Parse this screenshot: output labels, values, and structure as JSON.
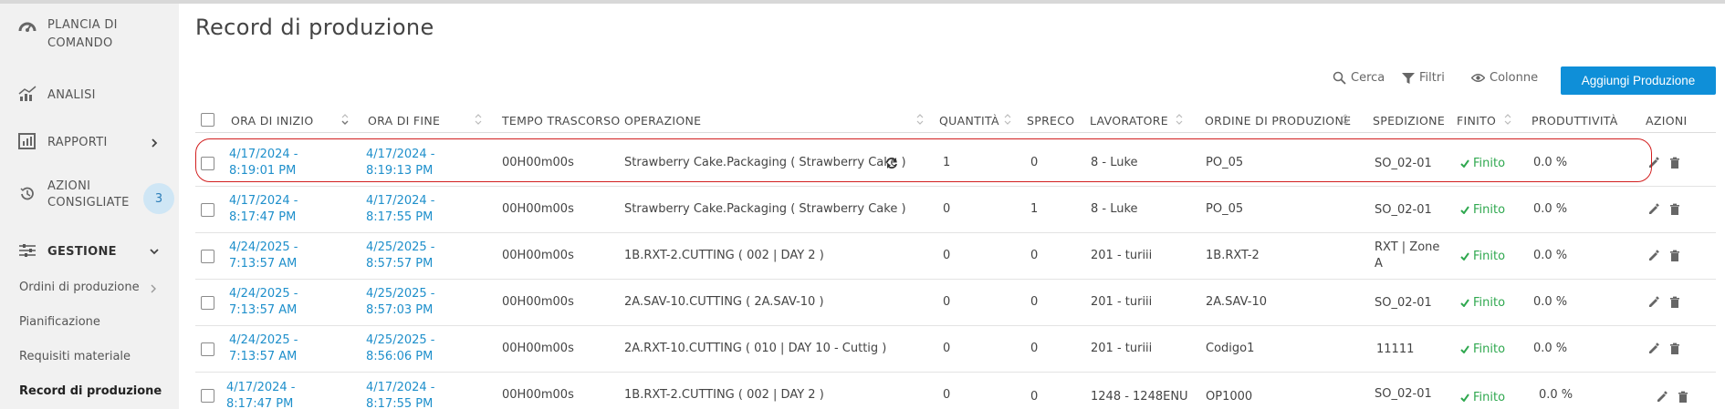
{
  "sidebar": {
    "dashboard_label": "PLANCIA DI COMANDO",
    "analysis_label": "ANALISI",
    "reports_label": "RAPPORTI",
    "suggested_label": "AZIONI CONSIGLIATE",
    "suggested_count": "3",
    "management_label": "GESTIONE",
    "sub_items": [
      {
        "label": "Ordini di produzione"
      },
      {
        "label": "Pianificazione"
      },
      {
        "label": "Requisiti materiale"
      },
      {
        "label": "Record di produzione"
      }
    ]
  },
  "page": {
    "title": "Record di produzione"
  },
  "toolbar": {
    "search_label": "Cerca",
    "filters_label": "Filtri",
    "columns_label": "Colonne",
    "add_label": "Aggiungi Produzione"
  },
  "table": {
    "columns": [
      "ORA DI INIZIO",
      "ORA DI FINE",
      "TEMPO TRASCORSO",
      "OPERAZIONE",
      "QUANTITÀ",
      "SPRECO",
      "LAVORATORE",
      "ORDINE DI PRODUZIONE",
      "SPEDIZIONE",
      "FINITO",
      "PRODUTTIVITÀ",
      "AZIONI"
    ],
    "rows": [
      {
        "start": "4/17/2024 - 8:19:01 PM",
        "end": "4/17/2024 - 8:19:13 PM",
        "elapsed": "00H00m00s",
        "operation": "Strawberry Cake.Packaging ( Strawberry Cake )",
        "qty": "1",
        "waste": "0",
        "worker": "8 - Luke",
        "order": "PO_05",
        "shipping": "SO_02-01",
        "finished": "Finito",
        "productivity": "0.0 %"
      },
      {
        "start": "4/17/2024 - 8:17:47 PM",
        "end": "4/17/2024 - 8:17:55 PM",
        "elapsed": "00H00m00s",
        "operation": "Strawberry Cake.Packaging ( Strawberry Cake )",
        "qty": "0",
        "waste": "1",
        "worker": "8 - Luke",
        "order": "PO_05",
        "shipping": "SO_02-01",
        "finished": "Finito",
        "productivity": "0.0 %"
      },
      {
        "start": "4/24/2025 - 7:13:57 AM",
        "end": "4/25/2025 - 8:57:57 PM",
        "elapsed": "00H00m00s",
        "operation": "1B.RXT-2.CUTTING ( 002 | DAY 2 )",
        "qty": "0",
        "waste": "0",
        "worker": "201 - turiii",
        "order": "1B.RXT-2",
        "shipping": "RXT | Zone A",
        "finished": "Finito",
        "productivity": "0.0 %"
      },
      {
        "start": "4/24/2025 - 7:13:57 AM",
        "end": "4/25/2025 - 8:57:03 PM",
        "elapsed": "00H00m00s",
        "operation": "2A.SAV-10.CUTTING ( 2A.SAV-10 )",
        "qty": "0",
        "waste": "0",
        "worker": "201 - turiii",
        "order": "2A.SAV-10",
        "shipping": "SO_02-01",
        "finished": "Finito",
        "productivity": "0.0 %"
      },
      {
        "start": "4/24/2025 - 7:13:57 AM",
        "end": "4/25/2025 - 8:56:06 PM",
        "elapsed": "00H00m00s",
        "operation": "2A.RXT-10.CUTTING ( 010 | DAY 10 - Cuttig )",
        "qty": "0",
        "waste": "0",
        "worker": "201 - turiii",
        "order": "Codigo1",
        "shipping": "11111",
        "finished": "Finito",
        "productivity": "0.0 %"
      },
      {
        "start": "4/17/2024 - 8:17:47 PM",
        "end": "4/17/2024 - 8:17:55 PM",
        "elapsed": "00H00m00s",
        "operation": "1B.RXT-2.CUTTING ( 002 | DAY 2 )",
        "qty": "0",
        "waste": "0",
        "worker": "1248 - 1248ENU",
        "order": "OP1000",
        "shipping": "SO_02-01",
        "finished": "Finito",
        "productivity": "0.0 %"
      }
    ]
  },
  "colors": {
    "accent": "#0f8fd8",
    "link": "#1e8fcb",
    "success": "#2fa84f",
    "highlight": "#d21f1f"
  }
}
